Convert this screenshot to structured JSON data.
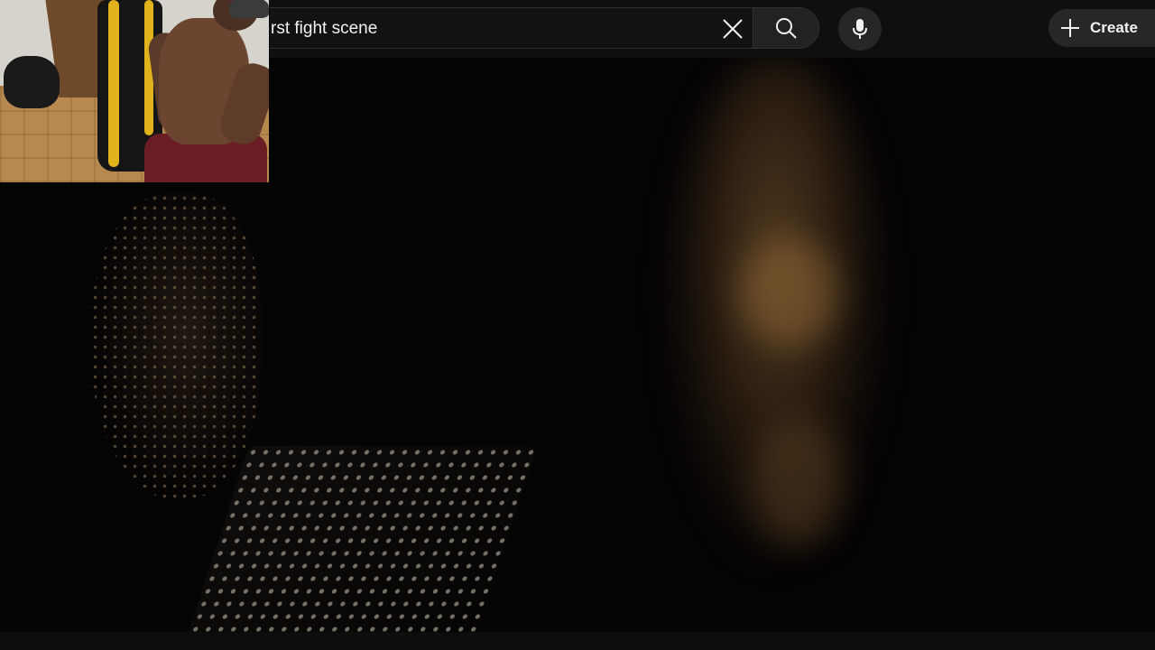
{
  "search": {
    "query": "rst fight scene"
  },
  "header": {
    "create_label": "Create"
  },
  "icons": {
    "clear": "close-icon",
    "search": "search-icon",
    "mic": "microphone-icon",
    "create": "plus-icon"
  },
  "colors": {
    "background": "#0f0f0f",
    "text": "#f1f1f1",
    "button_bg": "#272727",
    "search_border": "#303030"
  }
}
